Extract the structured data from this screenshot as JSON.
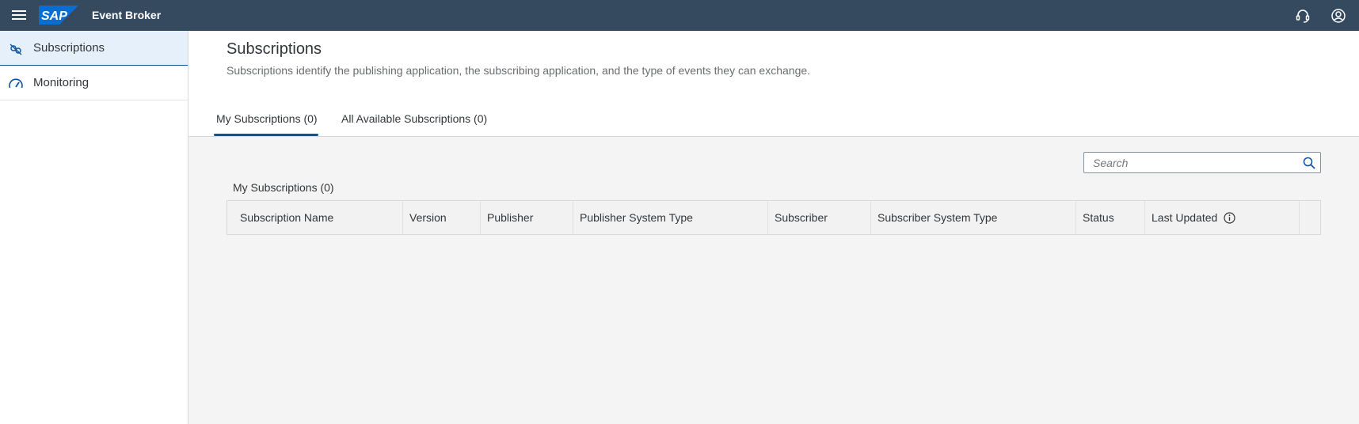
{
  "shellbar": {
    "logo_text": "SAP",
    "product_title": "Event Broker",
    "colors": {
      "background": "#354a5f",
      "logo": "#0a6ed1"
    },
    "icons": [
      "menu-icon",
      "headset-icon",
      "user-account-icon"
    ]
  },
  "sidenav": {
    "items": [
      {
        "label": "Subscriptions",
        "icon": "subscriptions-icon",
        "selected": true
      },
      {
        "label": "Monitoring",
        "icon": "gauge-icon",
        "selected": false
      }
    ]
  },
  "page": {
    "title": "Subscriptions",
    "description": "Subscriptions identify the publishing application, the subscribing application, and the type of events they can exchange."
  },
  "tabs": [
    {
      "label": "My Subscriptions (0)",
      "active": true
    },
    {
      "label": "All Available Subscriptions (0)",
      "active": false
    }
  ],
  "search": {
    "placeholder": "Search",
    "value": ""
  },
  "table": {
    "title": "My Subscriptions (0)",
    "columns": [
      "Subscription Name",
      "Version",
      "Publisher",
      "Publisher System Type",
      "Subscriber",
      "Subscriber System Type",
      "Status",
      "Last Updated"
    ],
    "rows": []
  },
  "colors": {
    "accent": "#0854a0",
    "selected_nav_bg": "#e5f0fa",
    "content_bg": "#f4f4f4"
  }
}
